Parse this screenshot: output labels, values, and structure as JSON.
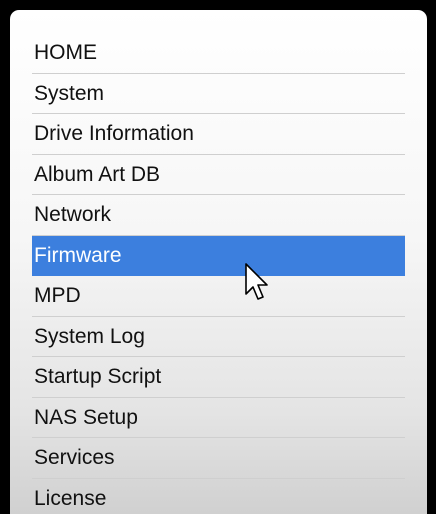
{
  "menu": {
    "items": [
      {
        "label": "HOME"
      },
      {
        "label": "System"
      },
      {
        "label": "Drive Information"
      },
      {
        "label": "Album Art DB"
      },
      {
        "label": "Network"
      },
      {
        "label": "Firmware",
        "selected": true
      },
      {
        "label": "MPD"
      },
      {
        "label": "System Log"
      },
      {
        "label": "Startup Script"
      },
      {
        "label": "NAS Setup"
      },
      {
        "label": "Services"
      },
      {
        "label": "License"
      }
    ],
    "selected_color": "#3c7fde"
  },
  "cursor": {
    "icon": "mouse-pointer-icon"
  }
}
